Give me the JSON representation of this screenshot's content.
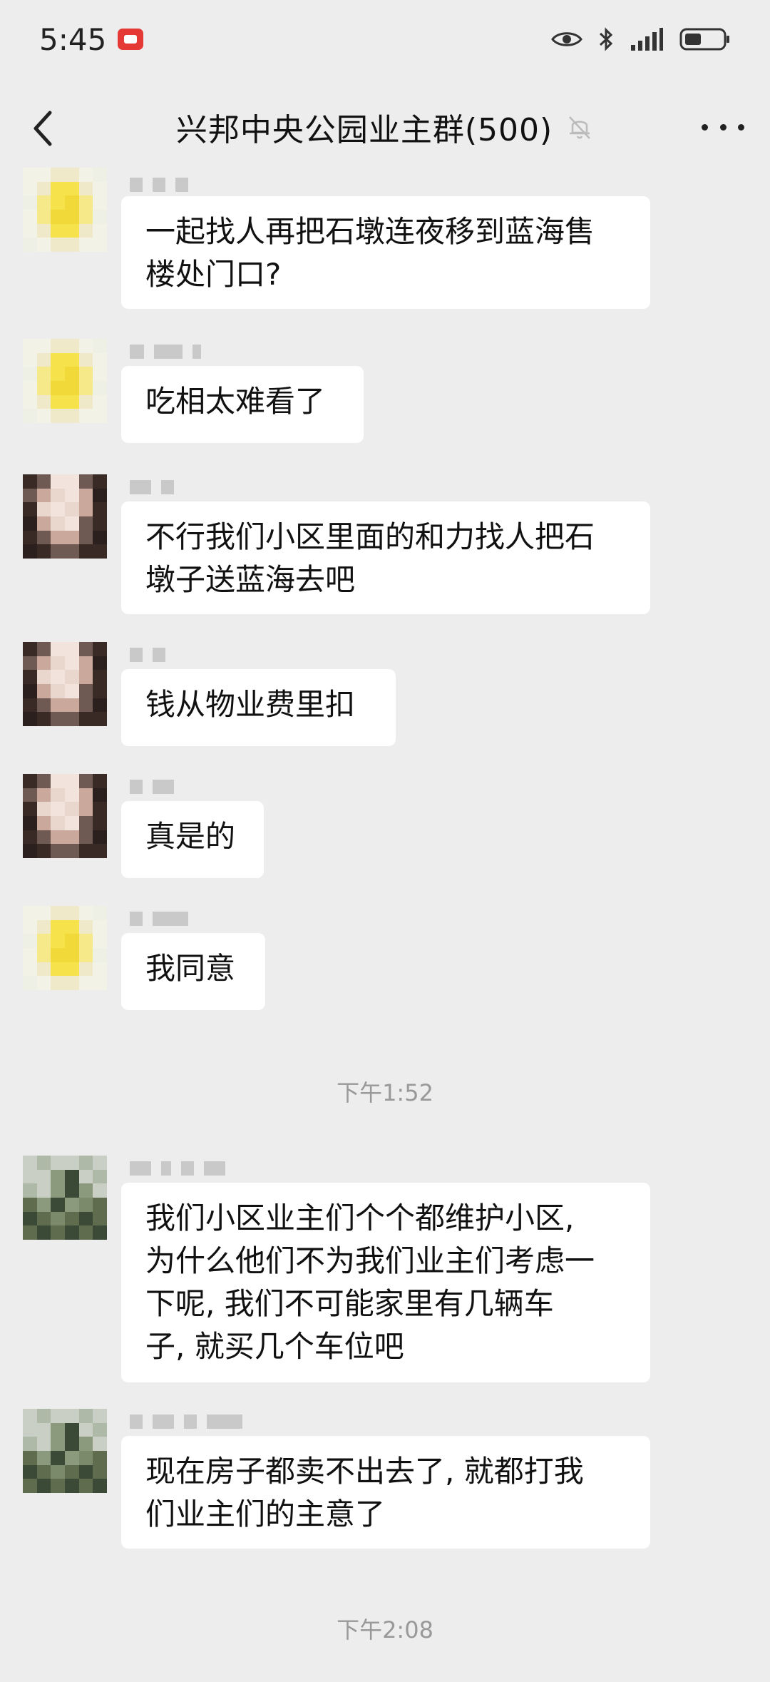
{
  "status": {
    "time": "5:45",
    "icons": [
      "notification-icon",
      "eye-icon",
      "bluetooth-icon",
      "signal-icon",
      "battery-icon"
    ]
  },
  "header": {
    "title": "兴邦中央公园业主群(500)",
    "icons": [
      "back-arrow-icon",
      "mute-bell-icon",
      "more-dots-icon"
    ]
  },
  "messages": [
    {
      "text": "一起找人再把石墩连夜移到蓝海售\n楼处门口?",
      "avatar": "yellow"
    },
    {
      "text": "吃相太难看了",
      "avatar": "yellow"
    },
    {
      "text": "不行我们小区里面的和力找人把石\n墩子送蓝海去吧",
      "avatar": "woman"
    },
    {
      "text": "钱从物业费里扣",
      "avatar": "woman"
    },
    {
      "text": "真是的",
      "avatar": "woman"
    },
    {
      "text": "我同意",
      "avatar": "yellow"
    },
    {
      "text": "我们小区业主们个个都维护小区,\n为什么他们不为我们业主们考虑一\n下呢, 我们不可能家里有几辆车\n子, 就买几个车位吧",
      "avatar": "landscape"
    },
    {
      "text": "现在房子都卖不出去了, 就都打我\n们业主们的主意了",
      "avatar": "landscape"
    }
  ],
  "timestamps": [
    "下午1:52",
    "下午2:08"
  ],
  "colors": {
    "background": "#ededed",
    "bubble": "#ffffff",
    "timestamp": "#999999",
    "notification": "#e53935"
  }
}
